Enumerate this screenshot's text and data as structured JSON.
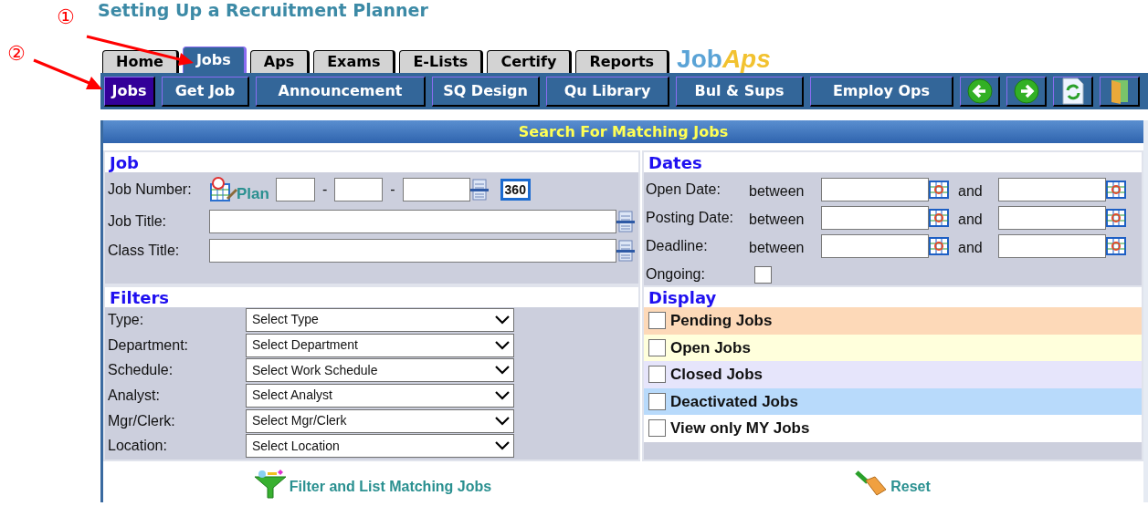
{
  "page_title": "Setting Up a Recruitment Planner",
  "annotations": [
    {
      "label": "①"
    },
    {
      "label": "②"
    }
  ],
  "tabs": [
    {
      "label": "Home",
      "selected": false
    },
    {
      "label": "Jobs",
      "selected": true
    },
    {
      "label": "Aps",
      "selected": false
    },
    {
      "label": "Exams",
      "selected": false
    },
    {
      "label": "E-Lists",
      "selected": false
    },
    {
      "label": "Certify",
      "selected": false
    },
    {
      "label": "Reports",
      "selected": false
    }
  ],
  "logo": {
    "part_1": "Job",
    "part_2": "Aps"
  },
  "subnav": [
    {
      "label": "Jobs",
      "selected": true
    },
    {
      "label": "Get Job",
      "selected": false
    },
    {
      "label": "Announcement",
      "selected": false
    },
    {
      "label": "SQ Design",
      "selected": false
    },
    {
      "label": "Qu Library",
      "selected": false
    },
    {
      "label": "Bul & Sups",
      "selected": false
    },
    {
      "label": "Employ Ops",
      "selected": false
    }
  ],
  "panel_title": "Search For Matching Jobs",
  "job": {
    "heading": "Job",
    "job_number_label": "Job Number:",
    "plan_link": "Plan",
    "separators": [
      "-",
      "-"
    ],
    "button_360": "360",
    "job_title_label": "Job Title:",
    "class_title_label": "Class Title:"
  },
  "dates": {
    "heading": "Dates",
    "rows": [
      {
        "label": "Open Date:",
        "between": "between",
        "and": "and"
      },
      {
        "label": "Posting Date:",
        "between": "between",
        "and": "and"
      },
      {
        "label": "Deadline:",
        "between": "between",
        "and": "and"
      }
    ],
    "ongoing": {
      "label": "Ongoing:",
      "checked": false
    }
  },
  "filters": {
    "heading": "Filters",
    "rows": [
      {
        "label": "Type:",
        "value": "Select Type"
      },
      {
        "label": "Department:",
        "value": "Select Department"
      },
      {
        "label": "Schedule:",
        "value": "Select Work Schedule"
      },
      {
        "label": "Analyst:",
        "value": "Select Analyst"
      },
      {
        "label": "Mgr/Clerk:",
        "value": "Select Mgr/Clerk"
      },
      {
        "label": "Location:",
        "value": "Select Location"
      }
    ]
  },
  "display": {
    "heading": "Display",
    "options": [
      {
        "label": "Pending Jobs",
        "checked": false,
        "color": "#fdd9b8"
      },
      {
        "label": "Open Jobs",
        "checked": false,
        "color": "#ffffdc"
      },
      {
        "label": "Closed Jobs",
        "checked": false,
        "color": "#e6e5fb"
      },
      {
        "label": "Deactivated Jobs",
        "checked": false,
        "color": "#b8dafb"
      },
      {
        "label": "View only MY Jobs",
        "checked": false,
        "color": "#ffffff"
      }
    ]
  },
  "actions": [
    {
      "label": "Filter and List Matching Jobs",
      "kind": "filter"
    },
    {
      "label": "Reset",
      "kind": "reset"
    }
  ]
}
